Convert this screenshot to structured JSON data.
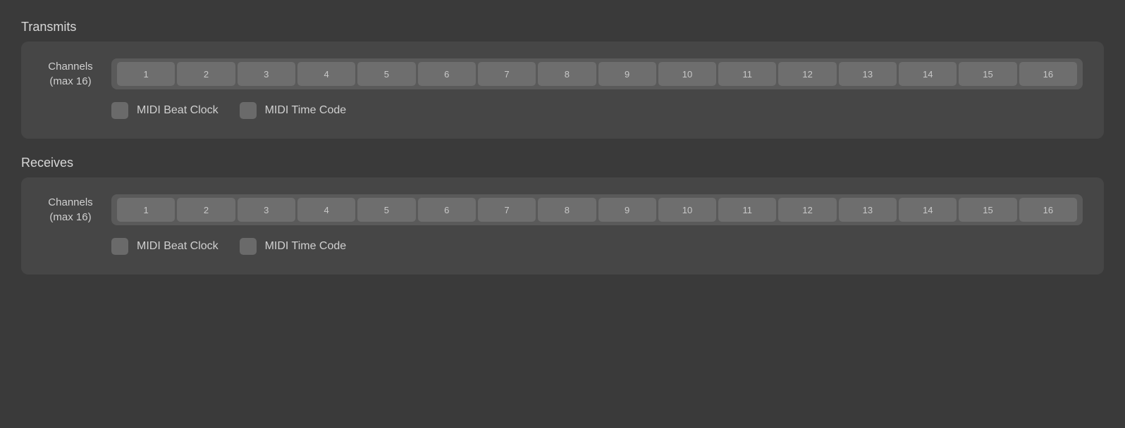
{
  "transmits": {
    "section_label": "Transmits",
    "channels_label_line1": "Channels",
    "channels_label_line2": "(max 16)",
    "channels": [
      "1",
      "2",
      "3",
      "4",
      "5",
      "6",
      "7",
      "8",
      "9",
      "10",
      "11",
      "12",
      "13",
      "14",
      "15",
      "16"
    ],
    "midi_beat_clock_label": "MIDI Beat Clock",
    "midi_time_code_label": "MIDI Time Code"
  },
  "receives": {
    "section_label": "Receives",
    "channels_label_line1": "Channels",
    "channels_label_line2": "(max 16)",
    "channels": [
      "1",
      "2",
      "3",
      "4",
      "5",
      "6",
      "7",
      "8",
      "9",
      "10",
      "11",
      "12",
      "13",
      "14",
      "15",
      "16"
    ],
    "midi_beat_clock_label": "MIDI Beat Clock",
    "midi_time_code_label": "MIDI Time Code"
  }
}
